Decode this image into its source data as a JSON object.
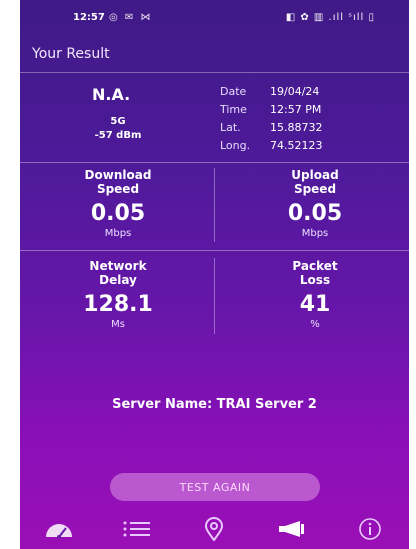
{
  "status_bar": {
    "time": "12:57",
    "left_icons_text": "◎ ✉ ⋈",
    "right_icons_text": "◧ ✿ ▥ .ıll ˢıll ▯"
  },
  "header": {
    "title": "Your Result"
  },
  "summary": {
    "operator": "N.A.",
    "network_type": "5G",
    "signal_strength": "-57 dBm",
    "details": [
      {
        "key": "Date",
        "value": "19/04/24"
      },
      {
        "key": "Time",
        "value": "12:57 PM"
      },
      {
        "key": "Lat.",
        "value": "15.88732"
      },
      {
        "key": "Long.",
        "value": "74.52123"
      }
    ]
  },
  "metrics": {
    "download": {
      "label_line1": "Download",
      "label_line2": "Speed",
      "value": "0.05",
      "unit": "Mbps"
    },
    "upload": {
      "label_line1": "Upload",
      "label_line2": "Speed",
      "value": "0.05",
      "unit": "Mbps"
    },
    "delay": {
      "label_line1": "Network",
      "label_line2": "Delay",
      "value": "128.1",
      "unit": "Ms"
    },
    "loss": {
      "label_line1": "Packet",
      "label_line2": "Loss",
      "value": "41",
      "unit": "%"
    }
  },
  "server": {
    "text": "Server Name: TRAI Server 2"
  },
  "actions": {
    "test_again_label": "TEST AGAIN"
  },
  "nav": {
    "items": [
      "speedometer-icon",
      "list-icon",
      "location-pin-icon",
      "megaphone-icon",
      "info-icon"
    ]
  },
  "colors": {
    "accent": "#ffffff",
    "gradient_top": "#3f1a86",
    "gradient_bottom": "#9a0fb5",
    "button_bg": "#d896e6"
  }
}
